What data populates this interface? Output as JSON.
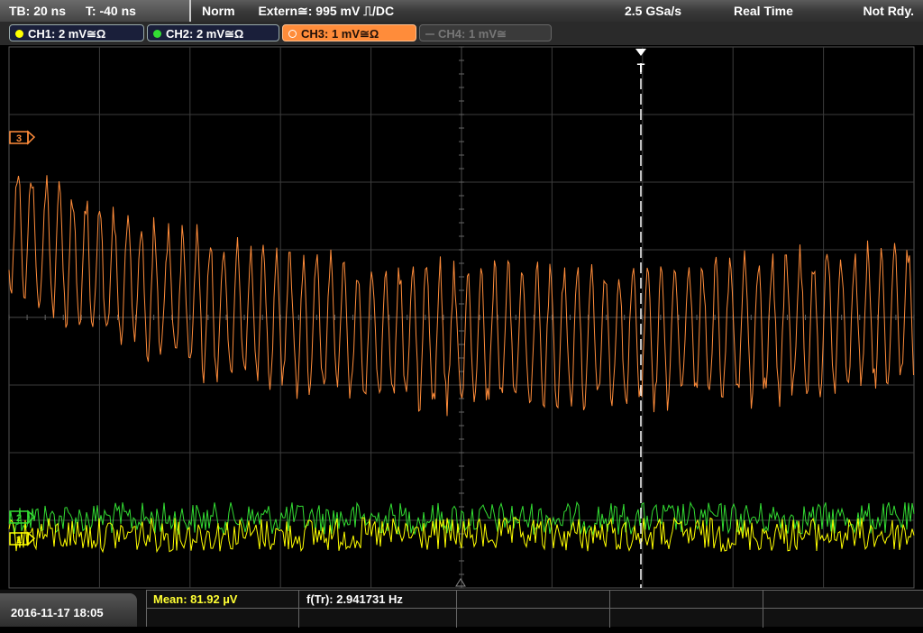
{
  "topbar": {
    "timebase": "TB: 20 ns",
    "trigger_offset": "T: -40 ns",
    "trigger_mode": "Norm",
    "trigger_source": "Extern≅: 995 mV ⎍/DC",
    "sample_rate": "2.5 GSa/s",
    "acq_mode": "Real Time",
    "state": "Not Rdy."
  },
  "channels": [
    {
      "label": "CH1: 2 mV≅Ω",
      "color": "#ffff00"
    },
    {
      "label": "CH2: 2 mV≅Ω",
      "color": "#33dd33"
    },
    {
      "label": "CH3: 1 mV≅Ω",
      "color": "#ff8c3a"
    },
    {
      "label": "CH4: 1 mV≅",
      "color": "#777777"
    }
  ],
  "trigger_marker": "T",
  "ground_markers": {
    "ch3": "3",
    "ch2": "2",
    "ch1": "1"
  },
  "bottombar": {
    "datetime": "2016-11-17 18:05",
    "mean": "Mean: 81.92 µV",
    "frequency": "f(Tr): 2.941731 Hz"
  },
  "grid": {
    "cols": 10,
    "rows": 8,
    "color": "#3c3c3c"
  }
}
